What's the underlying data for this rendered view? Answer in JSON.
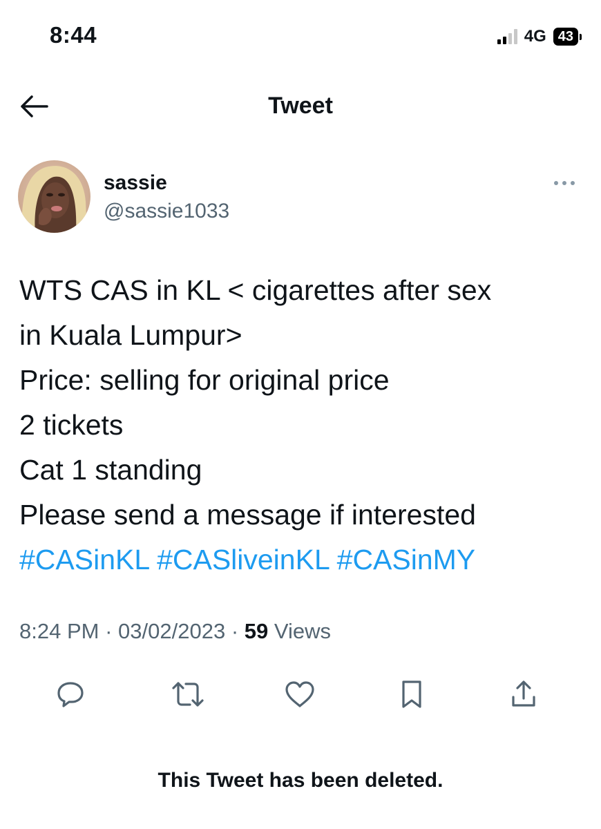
{
  "status_bar": {
    "time": "8:44",
    "network": "4G",
    "battery": "43"
  },
  "nav": {
    "title": "Tweet",
    "back_icon": "arrow-left-icon"
  },
  "tweet": {
    "author": {
      "display_name": "sassie",
      "handle": "@sassie1033"
    },
    "text_lines": [
      "WTS CAS in KL < cigarettes after sex",
      "in Kuala Lumpur>",
      "Price: selling for original price",
      "2 tickets",
      "Cat 1 standing",
      "Please send a message if interested"
    ],
    "hashtags": [
      "#CASinKL",
      "#CASliveinKL",
      "#CASinMY"
    ],
    "time": "8:24 PM",
    "date": "03/02/2023",
    "separator": "·",
    "views_count": "59",
    "views_label": "Views",
    "actions": [
      "reply-icon",
      "retweet-icon",
      "like-icon",
      "bookmark-icon",
      "share-icon"
    ]
  },
  "footer": {
    "deleted_notice": "This Tweet has been deleted."
  },
  "colors": {
    "text": "#0f1419",
    "secondary": "#536471",
    "link": "#1d9bf0",
    "background": "#ffffff"
  }
}
